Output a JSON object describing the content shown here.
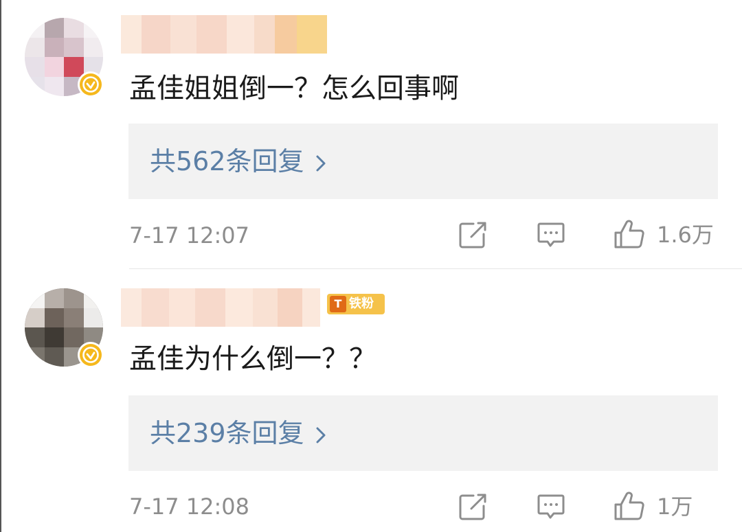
{
  "comments": [
    {
      "text": "孟佳姐姐倒一？怎么回事啊",
      "replies_label": "共562条回复",
      "timestamp": "7-17 12:07",
      "like_count": "1.6万",
      "verified": true,
      "icons": {
        "repost": "repost-icon",
        "reply": "comment-icon",
        "like": "thumbs-up-icon",
        "more": "chevron-right-icon"
      }
    },
    {
      "text": "孟佳为什么倒一？？",
      "replies_label": "共239条回复",
      "timestamp": "7-17 12:08",
      "like_count": "1万",
      "verified": true,
      "fan_badge": "铁粉",
      "icons": {
        "repost": "repost-icon",
        "reply": "comment-icon",
        "like": "thumbs-up-icon",
        "more": "chevron-right-icon"
      }
    }
  ],
  "colors": {
    "reply_link": "#5b7fa6",
    "meta_gray": "#8d8d8d",
    "reply_box_bg": "#f2f2f2",
    "verified_gold": "#f5b81d",
    "fan_badge_bg": "#f5c24a"
  }
}
